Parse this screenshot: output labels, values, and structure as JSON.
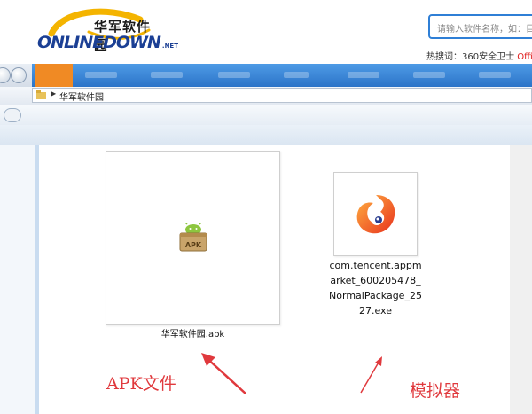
{
  "site": {
    "logo_cn": "华军软件园",
    "logo_en": "ONLINEDOWN",
    "logo_suffix": ".NET",
    "search_placeholder": "请输入软件名称，如：目",
    "hot_label": "热搜词：",
    "hot_item1": "360安全卫士",
    "hot_item2": "Offic"
  },
  "explorer": {
    "address": "华军软件园",
    "files": [
      {
        "name": "华军软件园.apk",
        "icon": "apk-file-icon"
      },
      {
        "name": "com.tencent.appmarket_600205478_NormalPackage_2527.exe",
        "icon": "tencent-emulator-icon"
      }
    ]
  },
  "annotations": {
    "apk_label": "APK文件",
    "emulator_label": "模拟器",
    "color": "#e0393d"
  },
  "colors": {
    "nav_blue": "#2c74c8",
    "nav_home": "#f08a24",
    "search_border": "#2f7fd6"
  }
}
